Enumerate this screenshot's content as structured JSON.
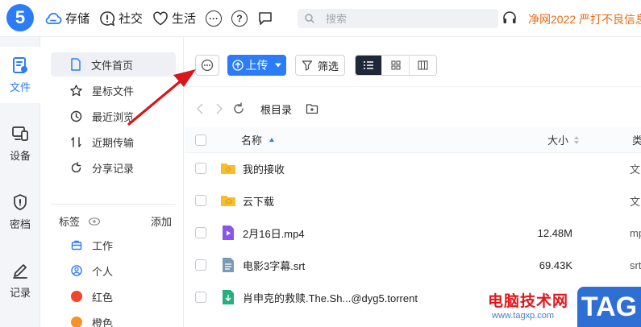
{
  "topbar": {
    "logo_text": "5",
    "nav": [
      {
        "label": "存储",
        "icon": "cloud-icon"
      },
      {
        "label": "社交",
        "icon": "chat-bubble-icon"
      },
      {
        "label": "生活",
        "icon": "heart-icon"
      }
    ],
    "more_icon": "more-dots-icon",
    "help_icon": "help-icon",
    "message_icon": "message-icon",
    "search_placeholder": "搜索",
    "notice": "净网2022 严打不良信息"
  },
  "sidebar": {
    "items": [
      {
        "label": "文件",
        "icon": "file-icon",
        "active": true
      },
      {
        "label": "设备",
        "icon": "device-icon",
        "active": false
      },
      {
        "label": "密档",
        "icon": "shield-lock-icon",
        "active": false
      },
      {
        "label": "记录",
        "icon": "pencil-icon",
        "active": false
      }
    ]
  },
  "subnav": {
    "items": [
      {
        "label": "文件首页",
        "icon": "file-home-icon",
        "active": true
      },
      {
        "label": "星标文件",
        "icon": "star-icon",
        "active": false
      },
      {
        "label": "最近浏览",
        "icon": "clock-icon",
        "active": false
      },
      {
        "label": "近期传输",
        "icon": "transfer-icon",
        "active": false
      },
      {
        "label": "分享记录",
        "icon": "share-icon",
        "active": false
      }
    ],
    "tags_title": "标签",
    "tags_add": "添加",
    "tags": [
      {
        "label": "工作",
        "kind": "briefcase"
      },
      {
        "label": "个人",
        "kind": "person"
      },
      {
        "label": "红色",
        "color": "#f0452c"
      },
      {
        "label": "橙色",
        "color": "#f7922a"
      }
    ]
  },
  "toolbar": {
    "upload_label": "上传",
    "filter_label": "筛选"
  },
  "path": {
    "label": "根目录"
  },
  "table": {
    "headers": {
      "name": "名称",
      "size": "大小",
      "type": "类"
    },
    "rows": [
      {
        "name": "我的接收",
        "size": "",
        "type": "文",
        "kind": "folder"
      },
      {
        "name": "云下载",
        "size": "",
        "type": "文",
        "kind": "folder-cloud"
      },
      {
        "name": "2月16日.mp4",
        "size": "12.48M",
        "type": "mp",
        "kind": "video"
      },
      {
        "name": "电影3字幕.srt",
        "size": "69.43K",
        "type": "srt",
        "kind": "doc"
      },
      {
        "name": "肖申克的救赎.The.Sh...@dyg5.torrent",
        "size": "",
        "type": "",
        "kind": "torrent"
      }
    ]
  },
  "watermark": {
    "text": "电脑技术网",
    "url": "www.tagxp.com",
    "badge": "TAG"
  },
  "colors": {
    "accent": "#2b7cf6",
    "notice": "#ec6a16",
    "arrow": "#d8171c"
  }
}
